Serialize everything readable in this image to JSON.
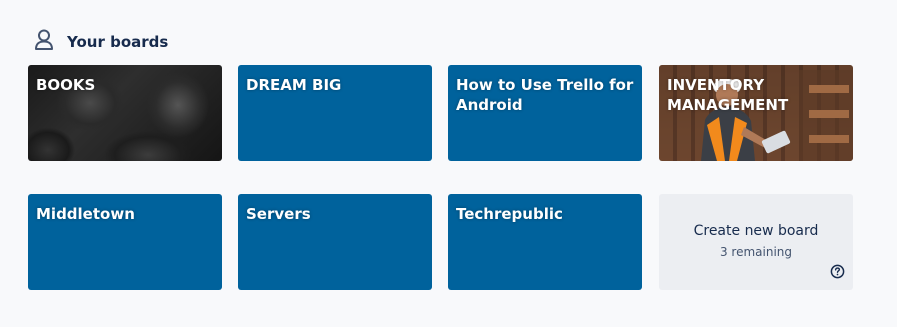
{
  "section": {
    "title": "Your boards",
    "icon": "person-icon"
  },
  "boards": [
    {
      "title": "BOOKS",
      "background": "image-dark"
    },
    {
      "title": "DREAM BIG",
      "background": "#00629c"
    },
    {
      "title": "How to Use Trello for Android",
      "background": "#00629c"
    },
    {
      "title": "INVENTORY MANAGEMENT",
      "background": "image-warehouse"
    },
    {
      "title": "Middletown",
      "background": "#00629c"
    },
    {
      "title": "Servers",
      "background": "#00629c"
    },
    {
      "title": "Techrepublic",
      "background": "#00629c"
    }
  ],
  "create_board": {
    "label": "Create new board",
    "remaining": "3 remaining",
    "help_icon": "help-circle-icon"
  },
  "colors": {
    "board_blue": "#00629c",
    "page_bg": "#f8f9fb",
    "text_dark": "#172b4d"
  }
}
